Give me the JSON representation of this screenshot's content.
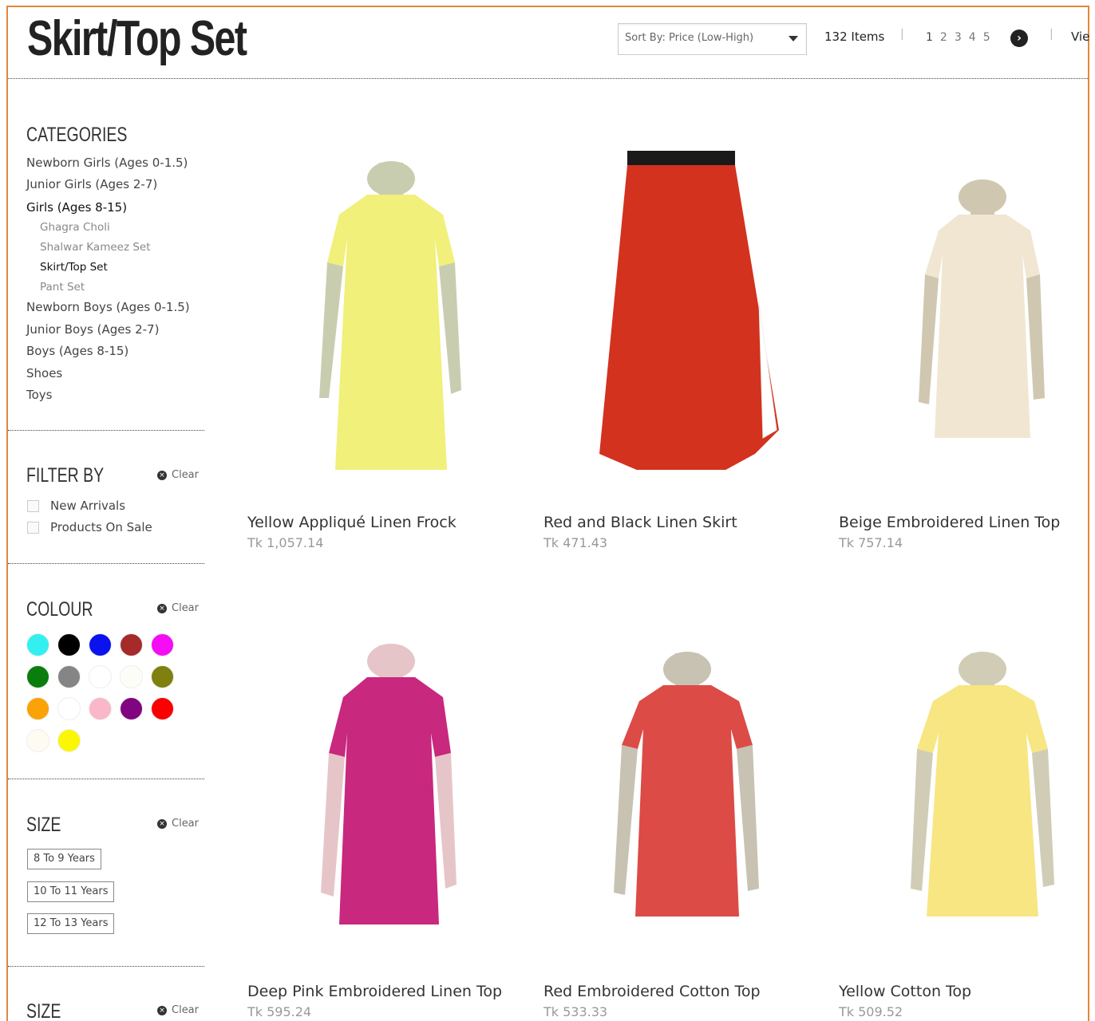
{
  "page": {
    "title": "Skirt/Top Set"
  },
  "toolbar": {
    "sort_label": "Sort By: Price (Low-High)",
    "items_count": "132 Items",
    "pages": [
      "1",
      "2",
      "3",
      "4",
      "5"
    ],
    "view_label": "Vie"
  },
  "categories": {
    "title": "CATEGORIES",
    "items": [
      {
        "label": "Newborn Girls (Ages 0-1.5)",
        "level": 0
      },
      {
        "label": "Junior Girls (Ages 2-7)",
        "level": 0
      },
      {
        "label": "Girls (Ages 8-15)",
        "level": 0,
        "active": true
      },
      {
        "label": "Ghagra Choli",
        "level": 1
      },
      {
        "label": "Shalwar Kameez Set",
        "level": 1
      },
      {
        "label": "Skirt/Top Set",
        "level": 1,
        "active": true
      },
      {
        "label": "Pant Set",
        "level": 1
      },
      {
        "label": "Newborn Boys (Ages 0-1.5)",
        "level": 0
      },
      {
        "label": "Junior Boys (Ages 2-7)",
        "level": 0
      },
      {
        "label": "Boys (Ages 8-15)",
        "level": 0
      },
      {
        "label": "Shoes",
        "level": 0
      },
      {
        "label": "Toys",
        "level": 0
      }
    ]
  },
  "filter_by": {
    "title": "FILTER BY",
    "clear_label": "Clear",
    "options": [
      "New Arrivals",
      "Products On Sale"
    ]
  },
  "colour": {
    "title": "COLOUR",
    "clear_label": "Clear",
    "swatches": [
      "#33f0f0",
      "#000000",
      "#0a12ee",
      "#a52b2a",
      "#f50df5",
      "#0a7d0d",
      "#858585",
      "#ffffff",
      "#fdfdf8",
      "#808010",
      "#fba206",
      "#ffffff",
      "#f9b7c9",
      "#810481",
      "#fb0000",
      "#fefcf2",
      "#fbf700"
    ]
  },
  "size": {
    "title": "SIZE",
    "clear_label": "Clear",
    "options": [
      "8 To 9 Years",
      "10 To 11 Years",
      "12 To 13 Years"
    ]
  },
  "size2": {
    "title": "SIZE",
    "clear_label": "Clear"
  },
  "products": [
    {
      "name": "Yellow Appliqué Linen Frock",
      "price": "Tk 1,057.14",
      "color": "#f0f07a"
    },
    {
      "name": "Red and Black Linen Skirt",
      "price": "Tk 471.43",
      "color": "#d2321e"
    },
    {
      "name": "Beige Embroidered Linen Top",
      "price": "Tk 757.14",
      "color": "#f0e6d2"
    },
    {
      "name": "Deep Pink Embroidered Linen Top",
      "price": "Tk 595.24",
      "color": "#c8287d"
    },
    {
      "name": "Red Embroidered Cotton Top",
      "price": "Tk 533.33",
      "color": "#dc4b46"
    },
    {
      "name": "Yellow Cotton Top",
      "price": "Tk 509.52",
      "color": "#f7e682"
    }
  ]
}
